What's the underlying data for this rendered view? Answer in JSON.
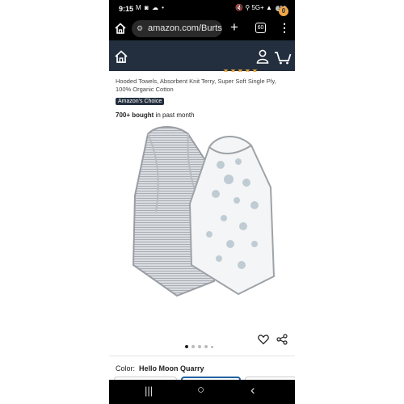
{
  "status_bar": {
    "time": "9:15",
    "left_icons": "M ◙ ☁ •",
    "right_icons": "🔇 ⚲ 5G+ ▲",
    "battery": "18"
  },
  "browser": {
    "url": "amazon.com/Burts-",
    "plus_label": "+",
    "tab_count": "60",
    "menu_label": "⋮"
  },
  "amazon_header": {
    "cart_count": "0"
  },
  "product": {
    "title": "Hooded Towels, Absorbent Knit Terry, Super Soft Single Ply, 100% Organic Cotton",
    "badge": "Amazon's Choice",
    "bought_bold": "700+ bought",
    "bought_rest": " in past month",
    "color_label": "Color:",
    "color_value": "Hello Moon Quarry"
  },
  "carousel": {
    "dot_count": 5,
    "active_index": 0
  },
  "icons": {
    "home": "home-icon",
    "amazon_home": "amazon-home-icon",
    "user": "user-icon",
    "cart": "cart-icon",
    "heart": "heart-icon",
    "share": "share-icon"
  },
  "nav": {
    "recents": "|||",
    "home": "○",
    "back": "‹"
  }
}
